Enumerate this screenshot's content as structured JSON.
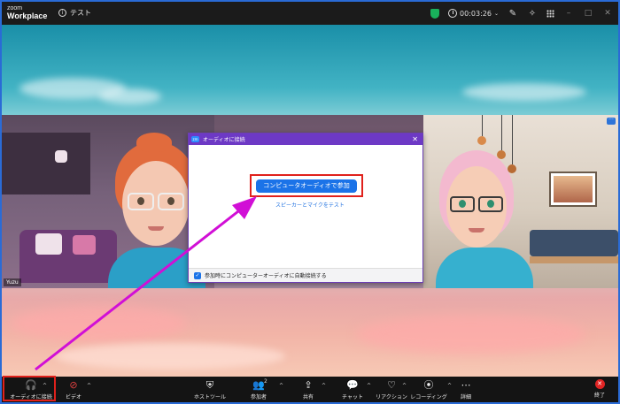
{
  "app": {
    "brand_top": "zoom",
    "brand_bottom": "Workplace",
    "meeting_name": "テスト",
    "timer": "00:03:26"
  },
  "participants": [
    {
      "name": "Yuzu"
    }
  ],
  "dialog": {
    "title": "オーディオに接続",
    "join_button": "コンピュータオーディオで参加",
    "test_link": "スピーカーとマイクをテスト",
    "auto_join_label": "参加時にコンピューターオーディオに自動接続する",
    "auto_join_checked": true
  },
  "toolbar": {
    "audio_label": "オーディオに接続",
    "video_label": "ビデオ",
    "host_tools_label": "ホストツール",
    "participants_label": "参加者",
    "participants_count": "2",
    "share_label": "共有",
    "chat_label": "チャット",
    "reactions_label": "リアクション",
    "record_label": "レコーディング",
    "more_label": "詳細",
    "end_label": "終了"
  },
  "colors": {
    "accent_blue": "#1b73e8",
    "dialog_purple": "#6d39c5",
    "highlight_red": "#e0211c",
    "arrow_magenta": "#d10fd6"
  }
}
